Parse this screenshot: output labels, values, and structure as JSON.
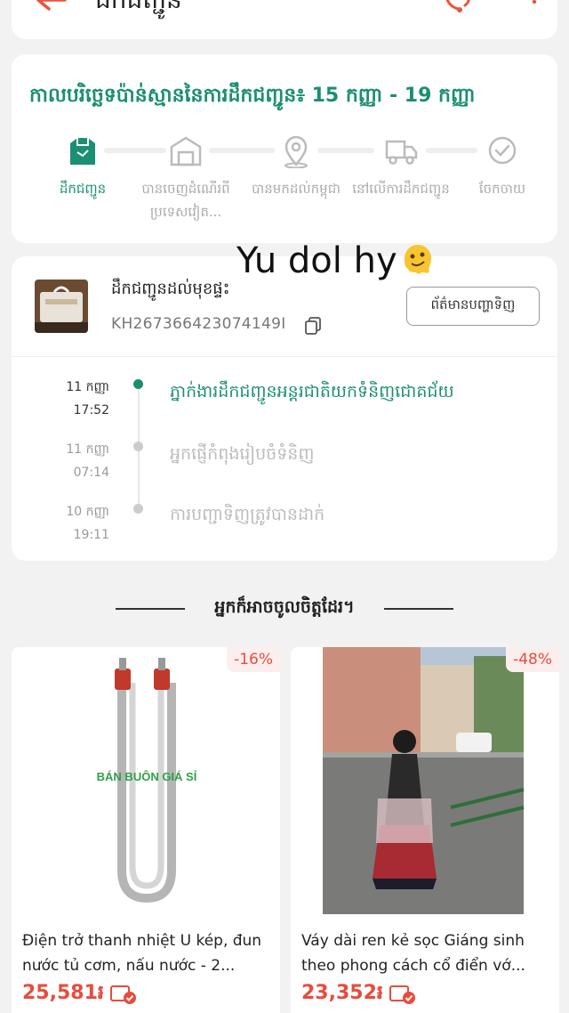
{
  "header": {
    "title": "ដឹកជញ្ជូន"
  },
  "shipping": {
    "eta": "កាលបរិច្ឆេទប៉ាន់ស្មាននៃការដឹកជញ្ជូន៖ 15 កញ្ញា - 19 កញ្ញា",
    "steps": [
      {
        "label": "ដឹកជញ្ជូន",
        "icon": "package-icon",
        "active": true
      },
      {
        "label": "បានចេញដំណើរពី ប្រទេសវៀត...",
        "icon": "warehouse-icon",
        "active": false
      },
      {
        "label": "បានមកដល់កម្ពុជា",
        "icon": "location-pin-icon",
        "active": false
      },
      {
        "label": "នៅលើការដឹកជញ្ជូន",
        "icon": "truck-icon",
        "active": false
      },
      {
        "label": "ចែកចាយ",
        "icon": "check-circle-icon",
        "active": false
      }
    ]
  },
  "tracking": {
    "title": "ដឹកជញ្ជូនដល់មុខផ្ទះ",
    "number": "KH267366423074149I",
    "issue_button": "ព័ត៌មានបញ្ហាទិញ",
    "events": [
      {
        "date": "11 កញ្ញា",
        "time": "17:52",
        "text": "ភ្នាក់ងារដឹកជញ្ជូនអន្តរជាតិយកទំនិញជោគជ័យ",
        "current": true
      },
      {
        "date": "11 កញ្ញា",
        "time": "07:14",
        "text": "អ្នកផ្ញើកំពុងរៀបចំទំនិញ",
        "current": false
      },
      {
        "date": "10 កញ្ញា",
        "time": "19:11",
        "text": "ការបញ្ជាទិញត្រូវបានដាក់",
        "current": false
      }
    ]
  },
  "overlay_text": "Yu dol hy",
  "recommendations": {
    "heading": "អ្នកក៏អាចចូលចិត្តដែរ។",
    "products": [
      {
        "name": "Điện trở thanh nhiệt U kép, đun nước tủ cơm, nấu nước - 2...",
        "price": "25,581៛",
        "discount": "-16%",
        "image_text": "BÁN BUÔN GIÁ SỈ"
      },
      {
        "name": "Váy dài ren kẻ sọc Giáng sinh theo phong cách cổ điển vớ...",
        "price": "23,352៛",
        "discount": "-48%"
      }
    ]
  },
  "colors": {
    "accent": "#1a8f72",
    "price": "#e84c3d",
    "header_icons": "#e8553f"
  }
}
